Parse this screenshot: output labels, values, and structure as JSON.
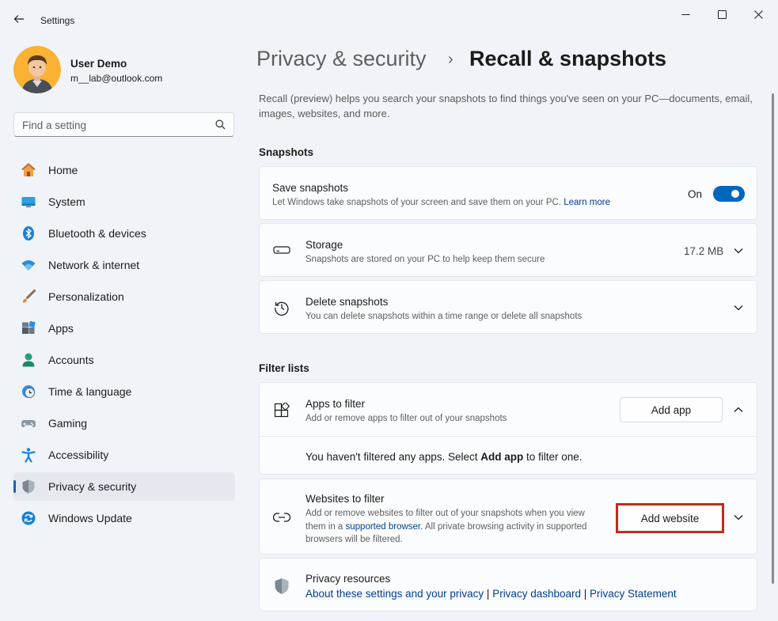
{
  "window": {
    "title": "Settings",
    "controls": [
      "minimize-icon",
      "maximize-icon",
      "close-icon"
    ]
  },
  "user": {
    "name": "User Demo",
    "email": "m__lab@outlook.com"
  },
  "search": {
    "placeholder": "Find a setting"
  },
  "nav": {
    "active": "Privacy & security",
    "items": [
      {
        "label": "Home",
        "icon": "home-icon"
      },
      {
        "label": "System",
        "icon": "system-icon"
      },
      {
        "label": "Bluetooth & devices",
        "icon": "bluetooth-icon"
      },
      {
        "label": "Network & internet",
        "icon": "wifi-icon"
      },
      {
        "label": "Personalization",
        "icon": "brush-icon"
      },
      {
        "label": "Apps",
        "icon": "apps-icon"
      },
      {
        "label": "Accounts",
        "icon": "account-icon"
      },
      {
        "label": "Time & language",
        "icon": "clock-globe-icon"
      },
      {
        "label": "Gaming",
        "icon": "gamepad-icon"
      },
      {
        "label": "Accessibility",
        "icon": "accessibility-icon"
      },
      {
        "label": "Privacy & security",
        "icon": "shield-icon"
      },
      {
        "label": "Windows Update",
        "icon": "update-icon"
      }
    ]
  },
  "breadcrumb": {
    "parent": "Privacy & security",
    "separator": "›",
    "current": "Recall & snapshots"
  },
  "description": "Recall (preview) helps you search your snapshots to find things you've seen on your PC—documents, email, images, websites, and more.",
  "snapshots": {
    "heading": "Snapshots",
    "save": {
      "title": "Save snapshots",
      "subtitle": "Let Windows take snapshots of your screen and save them on your PC.",
      "link": "Learn more",
      "state_label": "On",
      "enabled": true
    },
    "storage": {
      "title": "Storage",
      "subtitle": "Snapshots are stored on your PC to help keep them secure",
      "value": "17.2 MB"
    },
    "delete": {
      "title": "Delete snapshots",
      "subtitle": "You can delete snapshots within a time range or delete all snapshots"
    }
  },
  "filters": {
    "heading": "Filter lists",
    "apps": {
      "title": "Apps to filter",
      "subtitle": "Add or remove apps to filter out of your snapshots",
      "button": "Add app",
      "empty_pre": "You haven't filtered any apps. Select",
      "empty_bold": "Add app",
      "empty_post": "to filter one."
    },
    "websites": {
      "title": "Websites to filter",
      "subtitle_1": "Add or remove websites to filter out of your snapshots when you view them in a",
      "subtitle_link": "supported browser.",
      "subtitle_2": "All private browsing activity in supported browsers will be filtered.",
      "button": "Add website"
    }
  },
  "privacy_resources": {
    "title": "Privacy resources",
    "links": [
      "About these settings and your privacy",
      "Privacy dashboard",
      "Privacy Statement"
    ],
    "separator": "|"
  },
  "colors": {
    "accent": "#0067c0",
    "highlight_border": "#c42b1c"
  }
}
